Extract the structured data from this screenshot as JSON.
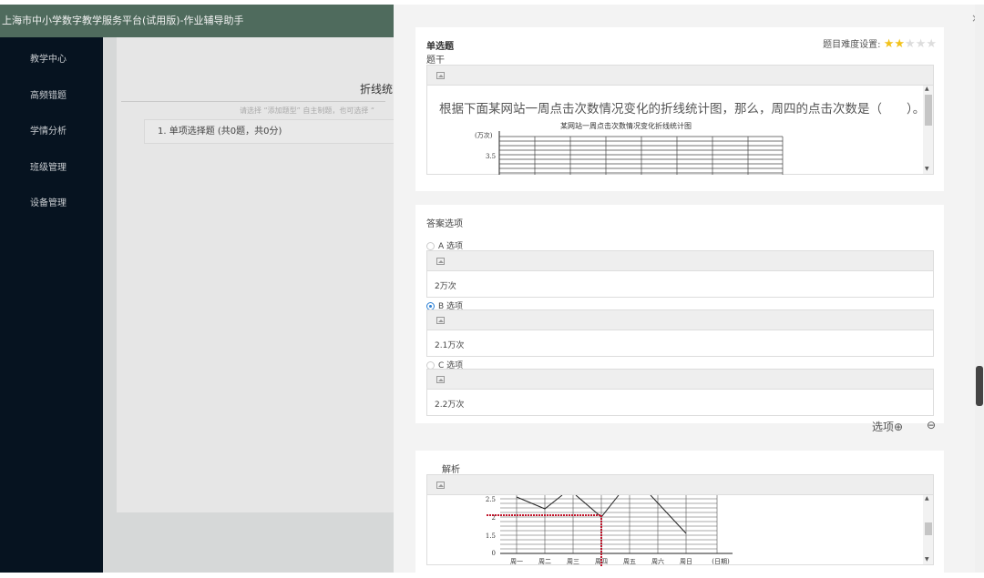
{
  "header": {
    "title": "上海市中小学数字教学服务平台(试用版)-作业辅导助手"
  },
  "sidebar": {
    "items": [
      {
        "label": "教学中心"
      },
      {
        "label": "高频错题"
      },
      {
        "label": "学情分析"
      },
      {
        "label": "班级管理"
      },
      {
        "label": "设备管理"
      }
    ]
  },
  "main": {
    "title": "折线统",
    "hint": "请选择 “添加题型” 自主制题，也可选择 “",
    "section": "1. 单项选择题 (共0题，共0分)"
  },
  "panel": {
    "close": "×",
    "question_type": "单选题",
    "difficulty_label": "题目难度设置:",
    "difficulty": 2,
    "difficulty_max": 5,
    "stem_label": "题干",
    "stem_text": "根据下面某网站一周点击次数情况变化的折线统计图，那么，周四的点击次数是（　　）。",
    "stem_chart": {
      "title": "某网站一周点击次数情况变化折线统计图",
      "unit": "(万次)",
      "tick": "3.5"
    },
    "answers_label": "答案选项",
    "options": [
      {
        "label": "A 选项",
        "value": "2万次",
        "selected": false
      },
      {
        "label": "B 选项",
        "value": "2.1万次",
        "selected": true
      },
      {
        "label": "C 选项",
        "value": "2.2万次",
        "selected": false
      }
    ],
    "add_option": "选项",
    "analysis_label": "解析",
    "analysis_chart": {
      "yticks": [
        "2.5",
        "2",
        "1.5",
        "0"
      ],
      "xticks": [
        "周一",
        "周二",
        "周三",
        "周四",
        "周五",
        "周六",
        "周日"
      ],
      "xlabel": "(日期)"
    }
  },
  "colors": {
    "header": "#4f6b5d",
    "sidebar": "#061320",
    "star": "#f2c21a",
    "radio": "#2a7fd4",
    "guide": "#c0142a"
  }
}
